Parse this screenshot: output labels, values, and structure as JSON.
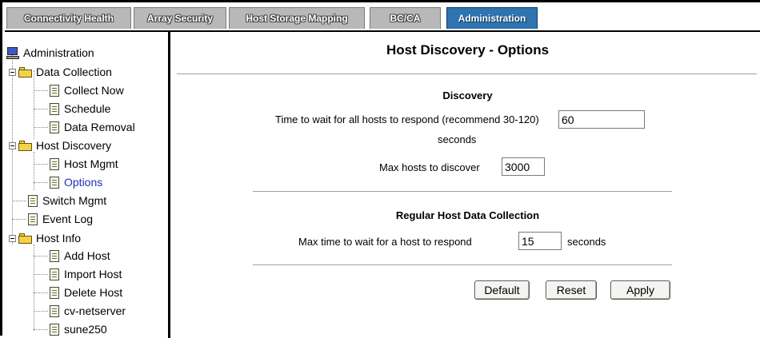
{
  "tabs": [
    {
      "label": "Connectivity Health",
      "active": false
    },
    {
      "label": "Array Security",
      "active": false
    },
    {
      "label": "Host Storage Mapping",
      "active": false
    },
    {
      "label": "BC/CA",
      "active": false
    },
    {
      "label": "Administration",
      "active": true
    }
  ],
  "tree": {
    "root": "Administration",
    "data_collection": "Data Collection",
    "collect_now": "Collect Now",
    "schedule": "Schedule",
    "data_removal": "Data Removal",
    "host_discovery": "Host Discovery",
    "host_mgmt": "Host Mgmt",
    "options": "Options",
    "switch_mgmt": "Switch Mgmt",
    "event_log": "Event Log",
    "host_info": "Host Info",
    "add_host": "Add Host",
    "import_host": "Import Host",
    "delete_host": "Delete Host",
    "cv_netserver": "cv-netserver",
    "sune250": "sune250"
  },
  "main": {
    "title": "Host Discovery - Options",
    "discovery": {
      "heading": "Discovery",
      "wait_label": "Time to wait for all hosts to respond (recommend 30-120)",
      "wait_value": "60",
      "wait_unit": "seconds",
      "max_hosts_label": "Max hosts to discover",
      "max_hosts_value": "3000"
    },
    "regular": {
      "heading": "Regular Host Data Collection",
      "max_time_label": "Max time to wait for a host to respond",
      "max_time_value": "15",
      "max_time_unit": "seconds"
    },
    "buttons": {
      "default": "Default",
      "reset": "Reset",
      "apply": "Apply"
    }
  },
  "colors": {
    "active_tab": "#2f73b0",
    "inactive_tab": "#b8b8b8",
    "selected_tree_text": "#1f2fb8"
  }
}
